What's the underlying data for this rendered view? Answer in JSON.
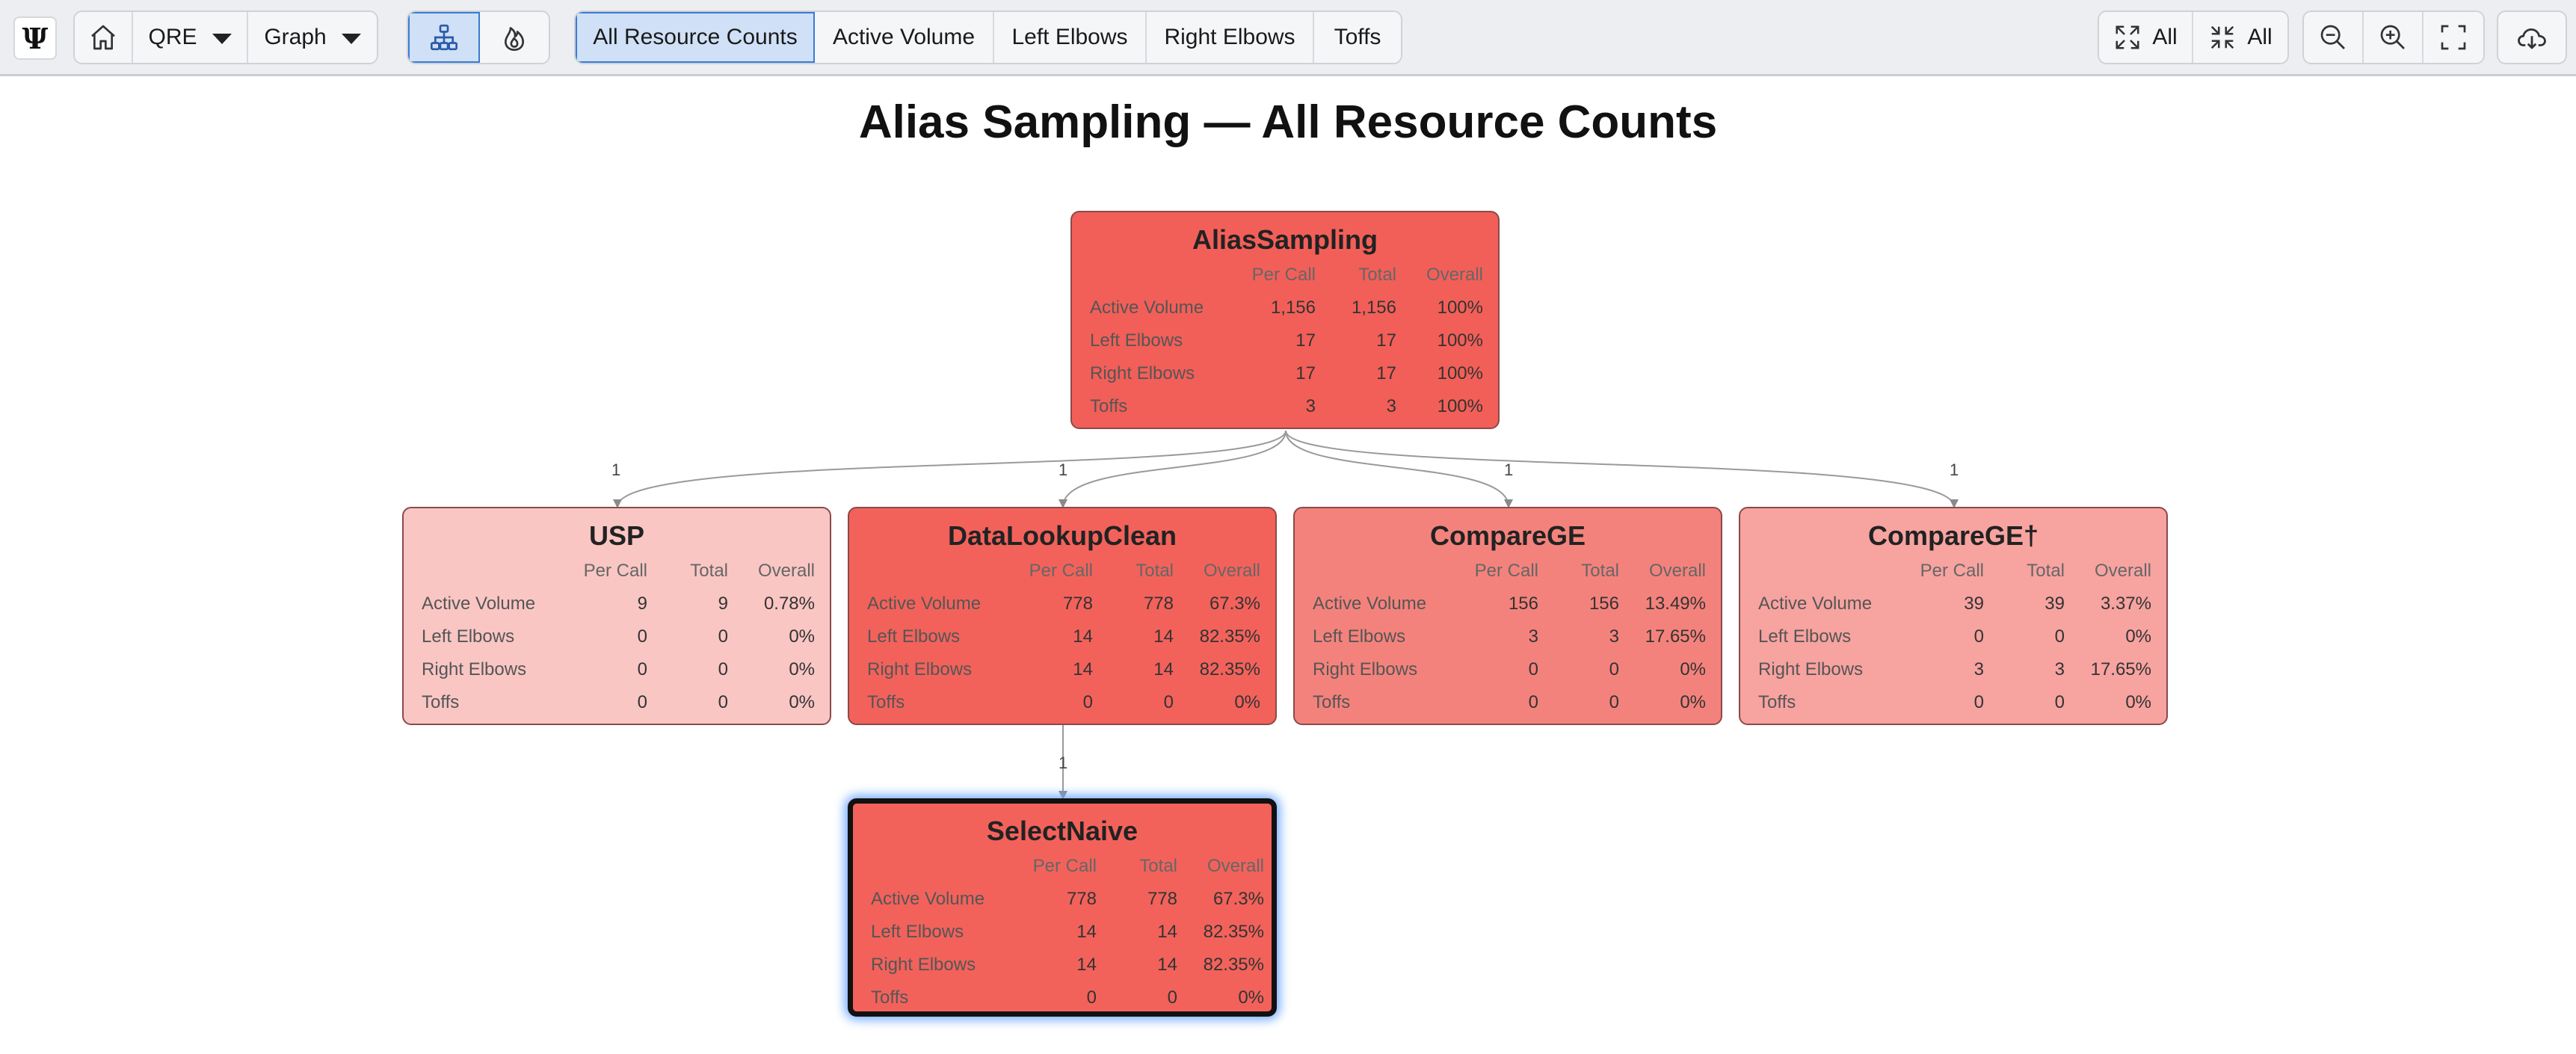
{
  "toolbar": {
    "logo": "Ψ",
    "home_icon": "home-icon",
    "dropdown_qre": "QRE",
    "dropdown_graph": "Graph",
    "view_buttons": [
      {
        "icon": "hierarchy-icon",
        "active": true
      },
      {
        "icon": "flame-icon",
        "active": false
      }
    ],
    "tabs": [
      {
        "label": "All Resource Counts",
        "active": true
      },
      {
        "label": "Active Volume",
        "active": false
      },
      {
        "label": "Left Elbows",
        "active": false
      },
      {
        "label": "Right Elbows",
        "active": false
      },
      {
        "label": "Toffs",
        "active": false
      }
    ],
    "expand_all_label": "All",
    "collapse_all_label": "All",
    "icons": [
      "expand-all-icon",
      "collapse-all-icon",
      "zoom-out-icon",
      "zoom-in-icon",
      "fit-screen-icon",
      "download-icon"
    ]
  },
  "title": "Alias Sampling — All Resource Counts",
  "table_headers": [
    "Per Call",
    "Total",
    "Overall"
  ],
  "nodes": [
    {
      "name": "AliasSampling",
      "color": "#f25f58",
      "rows": [
        {
          "label": "Active Volume",
          "per_call": "1,156",
          "total": "1,156",
          "overall": "100%"
        },
        {
          "label": "Left Elbows",
          "per_call": "17",
          "total": "17",
          "overall": "100%"
        },
        {
          "label": "Right Elbows",
          "per_call": "17",
          "total": "17",
          "overall": "100%"
        },
        {
          "label": "Toffs",
          "per_call": "3",
          "total": "3",
          "overall": "100%"
        }
      ]
    },
    {
      "name": "USP",
      "color": "#f9c6c4",
      "rows": [
        {
          "label": "Active Volume",
          "per_call": "9",
          "total": "9",
          "overall": "0.78%"
        },
        {
          "label": "Left Elbows",
          "per_call": "0",
          "total": "0",
          "overall": "0%"
        },
        {
          "label": "Right Elbows",
          "per_call": "0",
          "total": "0",
          "overall": "0%"
        },
        {
          "label": "Toffs",
          "per_call": "0",
          "total": "0",
          "overall": "0%"
        }
      ]
    },
    {
      "name": "DataLookupClean",
      "color": "#f2625b",
      "rows": [
        {
          "label": "Active Volume",
          "per_call": "778",
          "total": "778",
          "overall": "67.3%"
        },
        {
          "label": "Left Elbows",
          "per_call": "14",
          "total": "14",
          "overall": "82.35%"
        },
        {
          "label": "Right Elbows",
          "per_call": "14",
          "total": "14",
          "overall": "82.35%"
        },
        {
          "label": "Toffs",
          "per_call": "0",
          "total": "0",
          "overall": "0%"
        }
      ]
    },
    {
      "name": "CompareGE",
      "color": "#f4827c",
      "rows": [
        {
          "label": "Active Volume",
          "per_call": "156",
          "total": "156",
          "overall": "13.49%"
        },
        {
          "label": "Left Elbows",
          "per_call": "3",
          "total": "3",
          "overall": "17.65%"
        },
        {
          "label": "Right Elbows",
          "per_call": "0",
          "total": "0",
          "overall": "0%"
        },
        {
          "label": "Toffs",
          "per_call": "0",
          "total": "0",
          "overall": "0%"
        }
      ]
    },
    {
      "name": "CompareGE†",
      "color": "#f7a3a0",
      "rows": [
        {
          "label": "Active Volume",
          "per_call": "39",
          "total": "39",
          "overall": "3.37%"
        },
        {
          "label": "Left Elbows",
          "per_call": "0",
          "total": "0",
          "overall": "0%"
        },
        {
          "label": "Right Elbows",
          "per_call": "3",
          "total": "3",
          "overall": "17.65%"
        },
        {
          "label": "Toffs",
          "per_call": "0",
          "total": "0",
          "overall": "0%"
        }
      ]
    },
    {
      "name": "SelectNaive",
      "color": "#f2625b",
      "selected": true,
      "rows": [
        {
          "label": "Active Volume",
          "per_call": "778",
          "total": "778",
          "overall": "67.3%"
        },
        {
          "label": "Left Elbows",
          "per_call": "14",
          "total": "14",
          "overall": "82.35%"
        },
        {
          "label": "Right Elbows",
          "per_call": "14",
          "total": "14",
          "overall": "82.35%"
        },
        {
          "label": "Toffs",
          "per_call": "0",
          "total": "0",
          "overall": "0%"
        }
      ]
    }
  ],
  "edges": [
    {
      "from": "AliasSampling",
      "to": "USP",
      "label": "1"
    },
    {
      "from": "AliasSampling",
      "to": "DataLookupClean",
      "label": "1"
    },
    {
      "from": "AliasSampling",
      "to": "CompareGE",
      "label": "1"
    },
    {
      "from": "AliasSampling",
      "to": "CompareGE†",
      "label": "1"
    },
    {
      "from": "DataLookupClean",
      "to": "SelectNaive",
      "label": "1"
    }
  ]
}
